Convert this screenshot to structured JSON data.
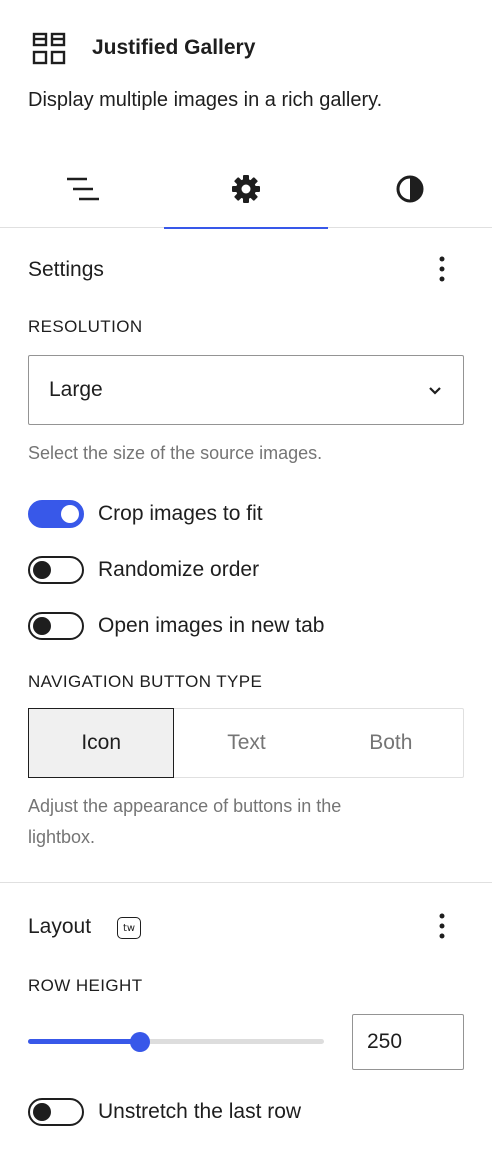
{
  "block": {
    "icon": "gallery-grid-icon",
    "title": "Justified Gallery",
    "description": "Display multiple images in a rich gallery."
  },
  "tabs": [
    {
      "icon": "list-view-icon",
      "active": false
    },
    {
      "icon": "gear-icon",
      "active": true
    },
    {
      "icon": "contrast-icon",
      "active": false
    }
  ],
  "settings": {
    "title": "Settings",
    "resolution": {
      "label": "Resolution",
      "value": "Large",
      "help": "Select the size of the source images."
    },
    "toggles": [
      {
        "label": "Crop images to fit",
        "checked": true
      },
      {
        "label": "Randomize order",
        "checked": false
      },
      {
        "label": "Open images in new tab",
        "checked": false
      }
    ],
    "navigation": {
      "label": "Navigation button type",
      "options": [
        "Icon",
        "Text",
        "Both"
      ],
      "selected": "Icon",
      "help_line1": "Adjust the appearance of buttons in the",
      "help_line2": "lightbox."
    }
  },
  "layout": {
    "title": "Layout",
    "badge": "tw",
    "row_height": {
      "label": "Row height",
      "value": "250",
      "fraction": 0.38
    },
    "toggle": {
      "label": "Unstretch the last row",
      "checked": false
    }
  },
  "colors": {
    "accent": "#3858e9",
    "text": "#1e1e1e",
    "muted": "#757575",
    "border": "#e0e0e0"
  }
}
